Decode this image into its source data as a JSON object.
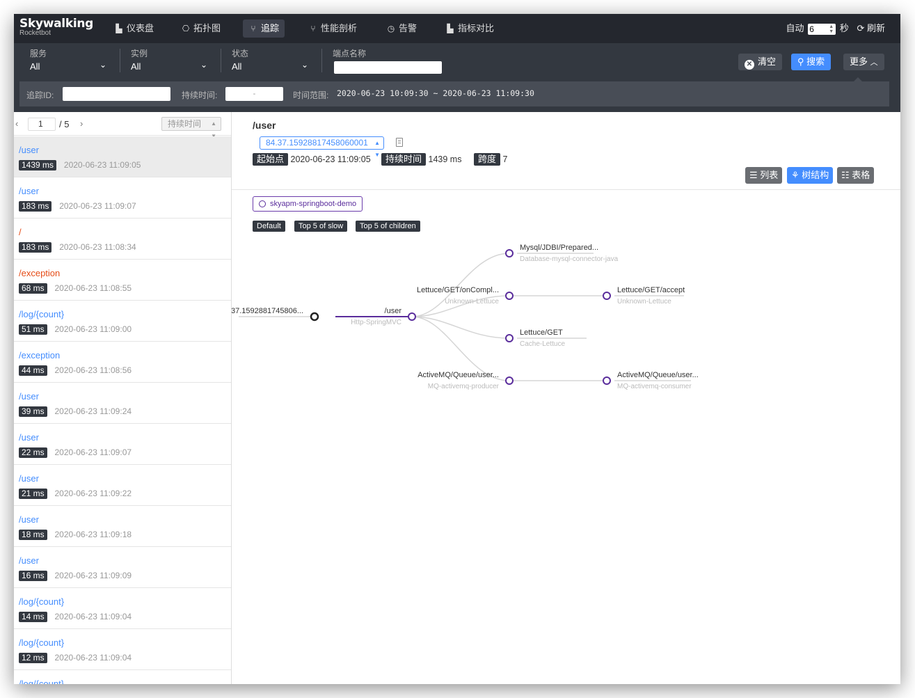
{
  "brand": {
    "name": "Skywalking",
    "sub": "Rocketbot"
  },
  "nav": [
    {
      "label": "仪表盘",
      "icon": "dashboard-icon",
      "glyph": "▙"
    },
    {
      "label": "拓扑图",
      "icon": "topology-icon",
      "glyph": "⎔"
    },
    {
      "label": "追踪",
      "icon": "trace-icon",
      "glyph": "⑂"
    },
    {
      "label": "性能剖析",
      "icon": "profile-icon",
      "glyph": "⑂"
    },
    {
      "label": "告警",
      "icon": "alarm-icon",
      "glyph": "◷"
    },
    {
      "label": "指标对比",
      "icon": "compare-icon",
      "glyph": "▙"
    }
  ],
  "auto_refresh": {
    "auto_label": "自动",
    "interval": "6",
    "unit": "秒",
    "refresh_label": "刷新"
  },
  "filters": {
    "service": {
      "label": "服务",
      "value": "All"
    },
    "instance": {
      "label": "实例",
      "value": "All"
    },
    "status": {
      "label": "状态",
      "value": "All"
    },
    "endpoint": {
      "label": "端点名称",
      "value": ""
    },
    "clear_label": "清空",
    "search_label": "搜索",
    "more_label": "更多",
    "trace_id_label": "追踪ID:",
    "trace_id_value": "",
    "duration_label": "持续时间:",
    "duration_value": "-",
    "time_range_label": "时间范围:",
    "time_range_value": "2020-06-23 10:09:30 ~ 2020-06-23 11:09:30"
  },
  "pager": {
    "page": "1",
    "total": "/ 5",
    "sort_label": "持续时间"
  },
  "traces": [
    {
      "endpoint": "/user",
      "duration": "1439 ms",
      "time": "2020-06-23 11:09:05",
      "error": false
    },
    {
      "endpoint": "/user",
      "duration": "183 ms",
      "time": "2020-06-23 11:09:07",
      "error": false
    },
    {
      "endpoint": "/",
      "duration": "183 ms",
      "time": "2020-06-23 11:08:34",
      "error": true
    },
    {
      "endpoint": "/exception",
      "duration": "68 ms",
      "time": "2020-06-23 11:08:55",
      "error": true
    },
    {
      "endpoint": "/log/{count}",
      "duration": "51 ms",
      "time": "2020-06-23 11:09:00",
      "error": false
    },
    {
      "endpoint": "/exception",
      "duration": "44 ms",
      "time": "2020-06-23 11:08:56",
      "error": false
    },
    {
      "endpoint": "/user",
      "duration": "39 ms",
      "time": "2020-06-23 11:09:24",
      "error": false
    },
    {
      "endpoint": "/user",
      "duration": "22 ms",
      "time": "2020-06-23 11:09:07",
      "error": false
    },
    {
      "endpoint": "/user",
      "duration": "21 ms",
      "time": "2020-06-23 11:09:22",
      "error": false
    },
    {
      "endpoint": "/user",
      "duration": "18 ms",
      "time": "2020-06-23 11:09:18",
      "error": false
    },
    {
      "endpoint": "/user",
      "duration": "16 ms",
      "time": "2020-06-23 11:09:09",
      "error": false
    },
    {
      "endpoint": "/log/{count}",
      "duration": "14 ms",
      "time": "2020-06-23 11:09:04",
      "error": false
    },
    {
      "endpoint": "/log/{count}",
      "duration": "12 ms",
      "time": "2020-06-23 11:09:04",
      "error": false
    },
    {
      "endpoint": "/log/{count}",
      "duration": "",
      "time": "",
      "error": false
    }
  ],
  "detail": {
    "title": "/user",
    "trace_id": "84.37.15928817458060001",
    "start_label": "起始点",
    "start_value": "2020-06-23 11:09:05",
    "duration_label": "持续时间",
    "duration_value": "1439 ms",
    "span_label": "跨度",
    "span_value": "7",
    "views": [
      "列表",
      "树结构",
      "表格"
    ],
    "service_chip": "skyapm-springboot-demo",
    "modes": [
      "Default",
      "Top 5 of slow",
      "Top 5 of children"
    ]
  },
  "tree": {
    "nodes": [
      {
        "label": "37.1592881745806...",
        "sub": ""
      },
      {
        "label": "/user",
        "sub": "Http-SpringMVC"
      },
      {
        "label": "Mysql/JDBI/Prepared...",
        "sub": "Database-mysql-connector-java"
      },
      {
        "label": "Lettuce/GET/onCompl...",
        "sub": "Unknown-Lettuce"
      },
      {
        "label": "Lettuce/GET",
        "sub": "Cache-Lettuce"
      },
      {
        "label": "ActiveMQ/Queue/user...",
        "sub": "MQ-activemq-producer"
      },
      {
        "label": "Lettuce/GET/accept",
        "sub": "Unknown-Lettuce"
      },
      {
        "label": "ActiveMQ/Queue/user...",
        "sub": "MQ-activemq-consumer"
      }
    ]
  },
  "colors": {
    "nav_bg": "#24272e",
    "filter_bg": "#333840",
    "accent": "#448dfe",
    "error": "#e54c17",
    "node": "#5a2d9c"
  }
}
